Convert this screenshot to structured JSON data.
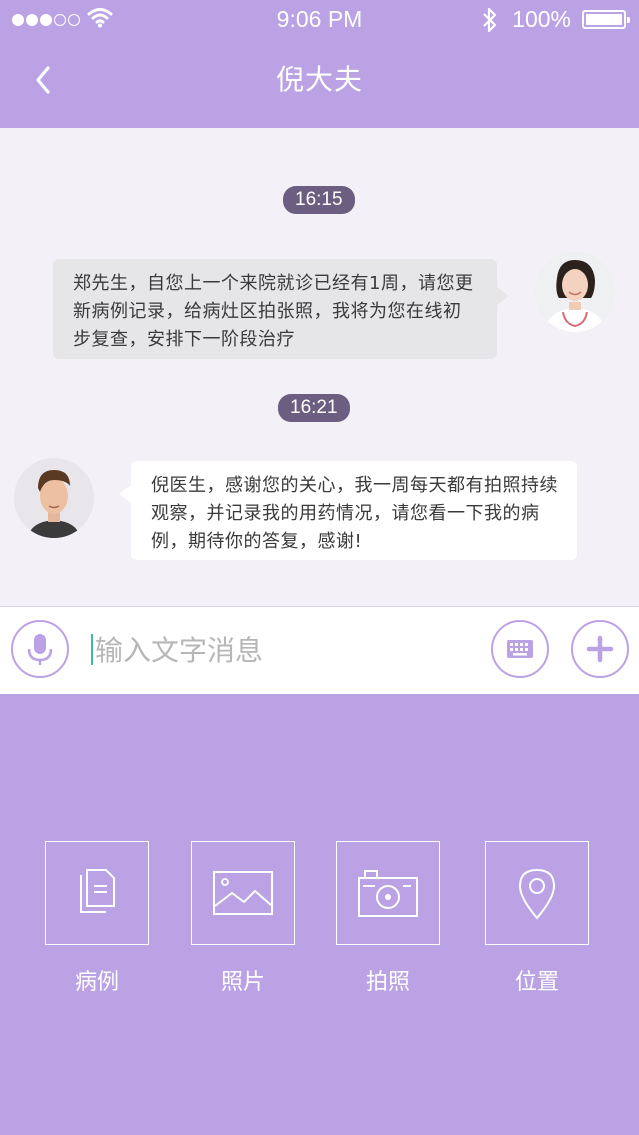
{
  "status_bar": {
    "time": "9:06 PM",
    "battery": "100%",
    "signal_icon": "signal-dots-icon",
    "wifi_icon": "wifi-icon",
    "bluetooth_icon": "bluetooth-icon"
  },
  "nav": {
    "title": "倪大夫",
    "back_icon": "chevron-left-icon"
  },
  "chat": {
    "messages": [
      {
        "time": "16:15",
        "sender": "doctor",
        "text": "郑先生，自您上一个来院就诊已经有1周，请您更新病例记录，给病灶区拍张照，我将为您在线初步复查，安排下一阶段治疗"
      },
      {
        "time": "16:21",
        "sender": "patient",
        "text": "倪医生，感谢您的关心，我一周每天都有拍照持续观察，并记录我的用药情况，请您看一下我的病例，期待你的答复，感谢!"
      }
    ]
  },
  "input_bar": {
    "placeholder": "输入文字消息",
    "value": "",
    "mic_icon": "microphone-icon",
    "keyboard_icon": "keyboard-icon",
    "plus_icon": "plus-icon"
  },
  "attachments": [
    {
      "label": "病例",
      "icon": "document-icon"
    },
    {
      "label": "照片",
      "icon": "image-icon"
    },
    {
      "label": "拍照",
      "icon": "camera-icon"
    },
    {
      "label": "位置",
      "icon": "location-pin-icon"
    }
  ],
  "colors": {
    "accent": "#bba2e5",
    "chat_bg": "#f3f1f7",
    "time_badge": "#6b5e80",
    "cursor": "#3dbab0"
  }
}
